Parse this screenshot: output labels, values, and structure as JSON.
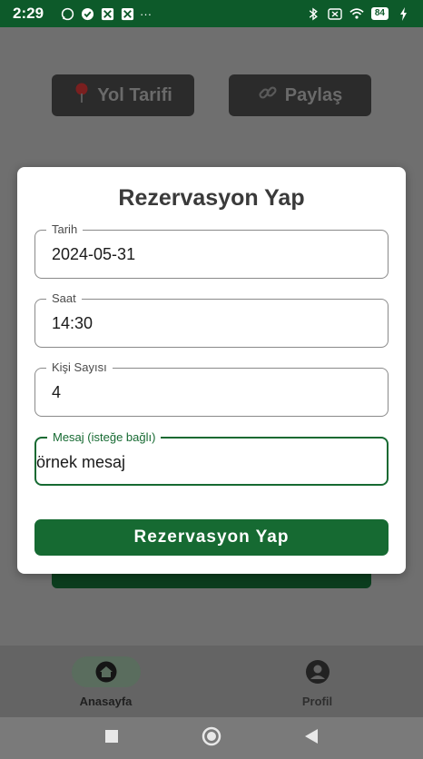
{
  "status_bar": {
    "time": "2:29",
    "battery": "84",
    "more": "···"
  },
  "background": {
    "route_button": "Yol Tarifi",
    "share_button": "Paylaş",
    "route_icon": "pin-icon",
    "share_icon": "link-icon"
  },
  "dialog": {
    "title": "Rezervasyon Yap",
    "fields": [
      {
        "label": "Tarih",
        "value": "2024-05-31"
      },
      {
        "label": "Saat",
        "value": "14:30"
      },
      {
        "label": "Kişi Sayısı",
        "value": "4"
      },
      {
        "label": "Mesaj (isteğe bağlı)",
        "value": "örnek mesaj"
      }
    ],
    "submit": "Rezervasyon Yap"
  },
  "bottom_nav": {
    "home": "Anasayfa",
    "profile": "Profil"
  },
  "colors": {
    "primary": "#166a32",
    "status_bar": "#0d5a2a"
  }
}
